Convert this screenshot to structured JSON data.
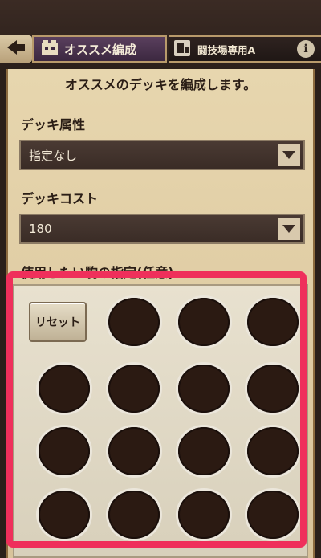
{
  "header": {
    "back_icon": "back-arrow-icon",
    "title": "オススメ編成",
    "title_icon": "deck-building-icon",
    "arena_label": "闘技場専用A",
    "arena_icon": "arena-icon",
    "info_label": "i"
  },
  "panel": {
    "intro": "オススメのデッキを編成します。",
    "attribute_label": "デッキ属性",
    "attribute_value": "指定なし",
    "cost_label": "デッキコスト",
    "cost_value": "180",
    "pieces_label": "使用したい駒の指定(任意)",
    "reset_label": "リセット"
  },
  "colors": {
    "highlight": "#ef2f5b",
    "parchment": "#e7d6ae",
    "select_bg": "#3a2c26"
  }
}
